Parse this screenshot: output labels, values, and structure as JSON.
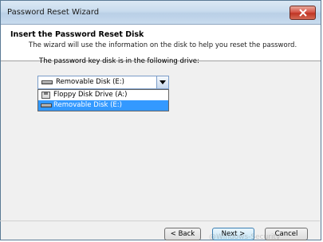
{
  "window": {
    "title": "Password Reset Wizard"
  },
  "header": {
    "title": "Insert the Password Reset Disk",
    "subtitle": "The wizard will use the information on the disk to help you reset the password."
  },
  "main": {
    "drive_label": "The password key disk is in the following drive:",
    "drive_select": {
      "selected": "Removable Disk (E:)",
      "options": [
        {
          "label": "Floppy Disk Drive (A:)",
          "icon": "floppy-drive-icon",
          "highlighted": false
        },
        {
          "label": "Removable Disk (E:)",
          "icon": "removable-disk-icon",
          "highlighted": true
        }
      ]
    }
  },
  "buttons": {
    "back": "< Back",
    "next": "Next >",
    "cancel": "Cancel"
  },
  "watermark": "@Windows-Security",
  "colors": {
    "highlight": "#3399ff",
    "close_button": "#c03524"
  }
}
